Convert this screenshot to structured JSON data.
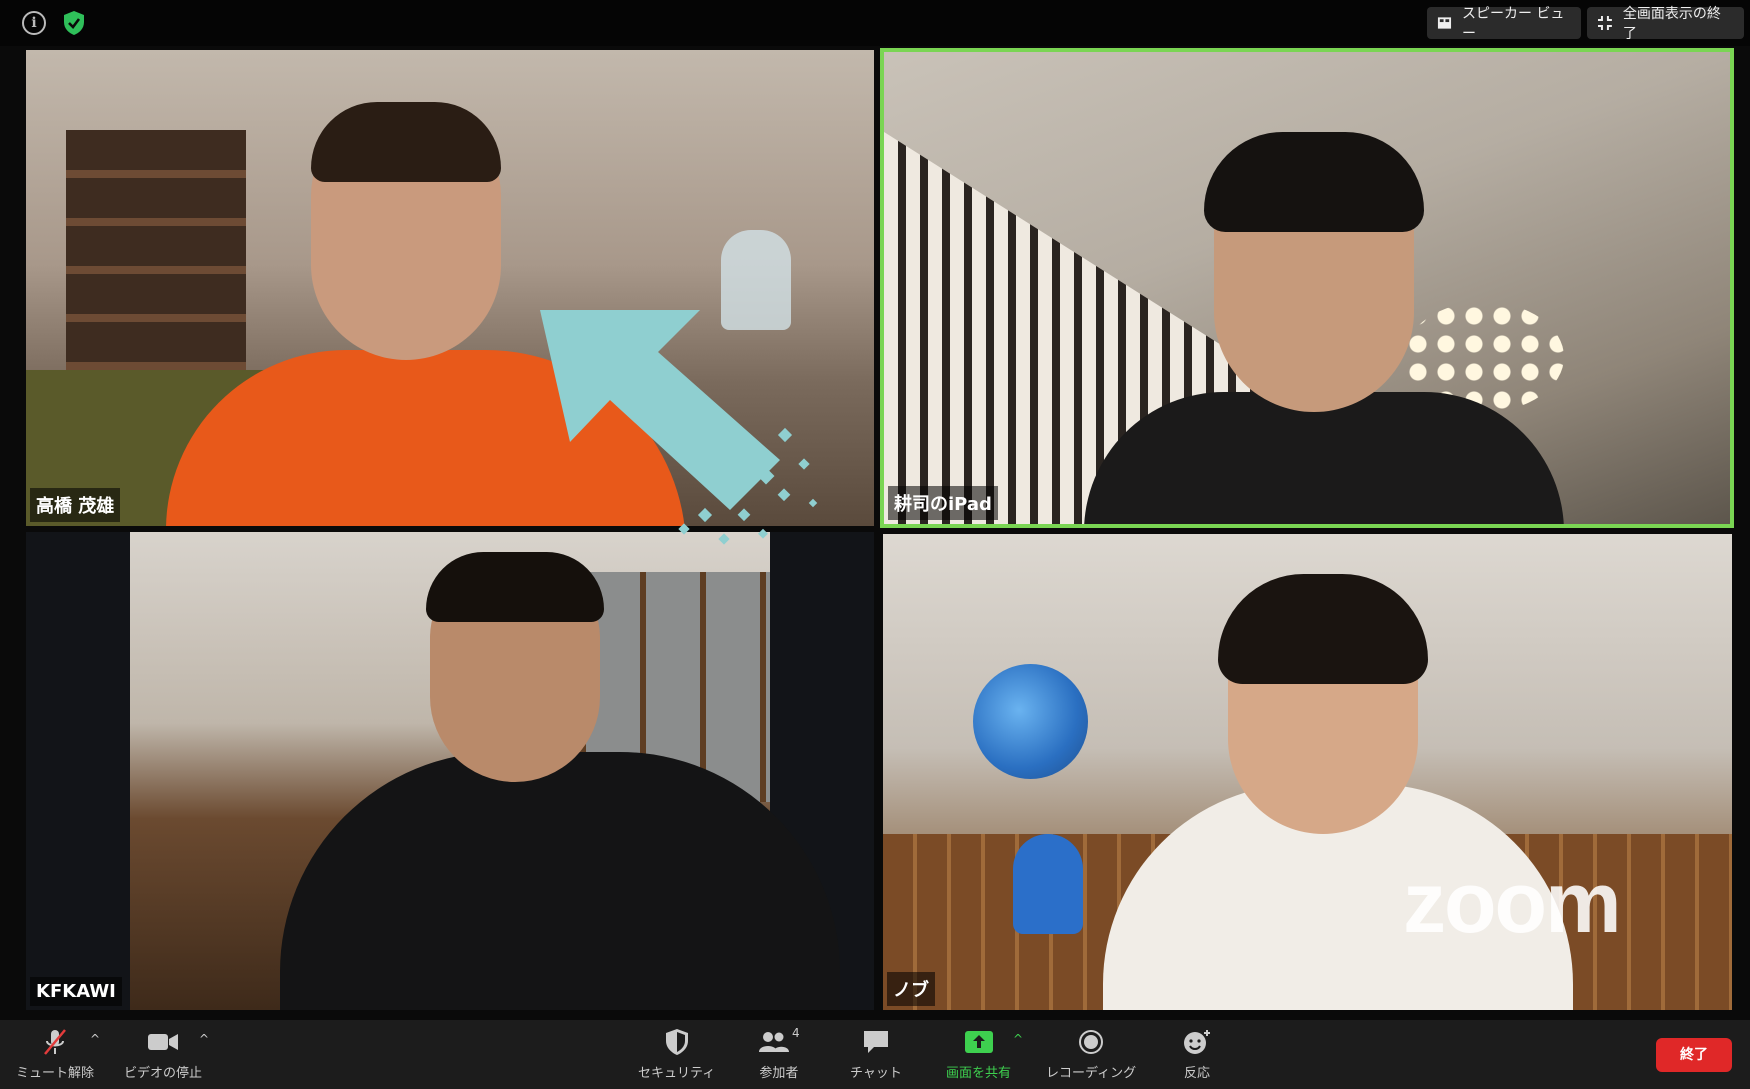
{
  "topbar": {
    "info_icon": "i",
    "speaker_view_label": "スピーカー ビュー",
    "exit_fullscreen_label": "全画面表示の終了"
  },
  "participants": [
    {
      "name": "高橋 茂雄"
    },
    {
      "name": "耕司のiPad"
    },
    {
      "name": "KFKAWI"
    },
    {
      "name": "ノブ"
    }
  ],
  "watermark": "zoom",
  "toolbar": {
    "mute_label": "ミュート解除",
    "video_label": "ビデオの停止",
    "security_label": "セキュリティ",
    "participants_label": "参加者",
    "participants_count": "4",
    "chat_label": "チャット",
    "share_label": "画面を共有",
    "record_label": "レコーディング",
    "reactions_label": "反応",
    "end_label": "終了"
  },
  "colors": {
    "active_speaker_border": "#7ad553",
    "share_green": "#3ed04f",
    "end_red": "#e02828",
    "arrow_teal": "#8fcfd0"
  },
  "icons": [
    "info-icon",
    "shield-check-icon",
    "speaker-view-icon",
    "exit-fullscreen-icon",
    "mic-muted-icon",
    "video-camera-icon",
    "security-shield-icon",
    "participants-icon",
    "chat-bubble-icon",
    "share-screen-icon",
    "record-icon",
    "reaction-smiley-icon",
    "chevron-up-icon"
  ]
}
